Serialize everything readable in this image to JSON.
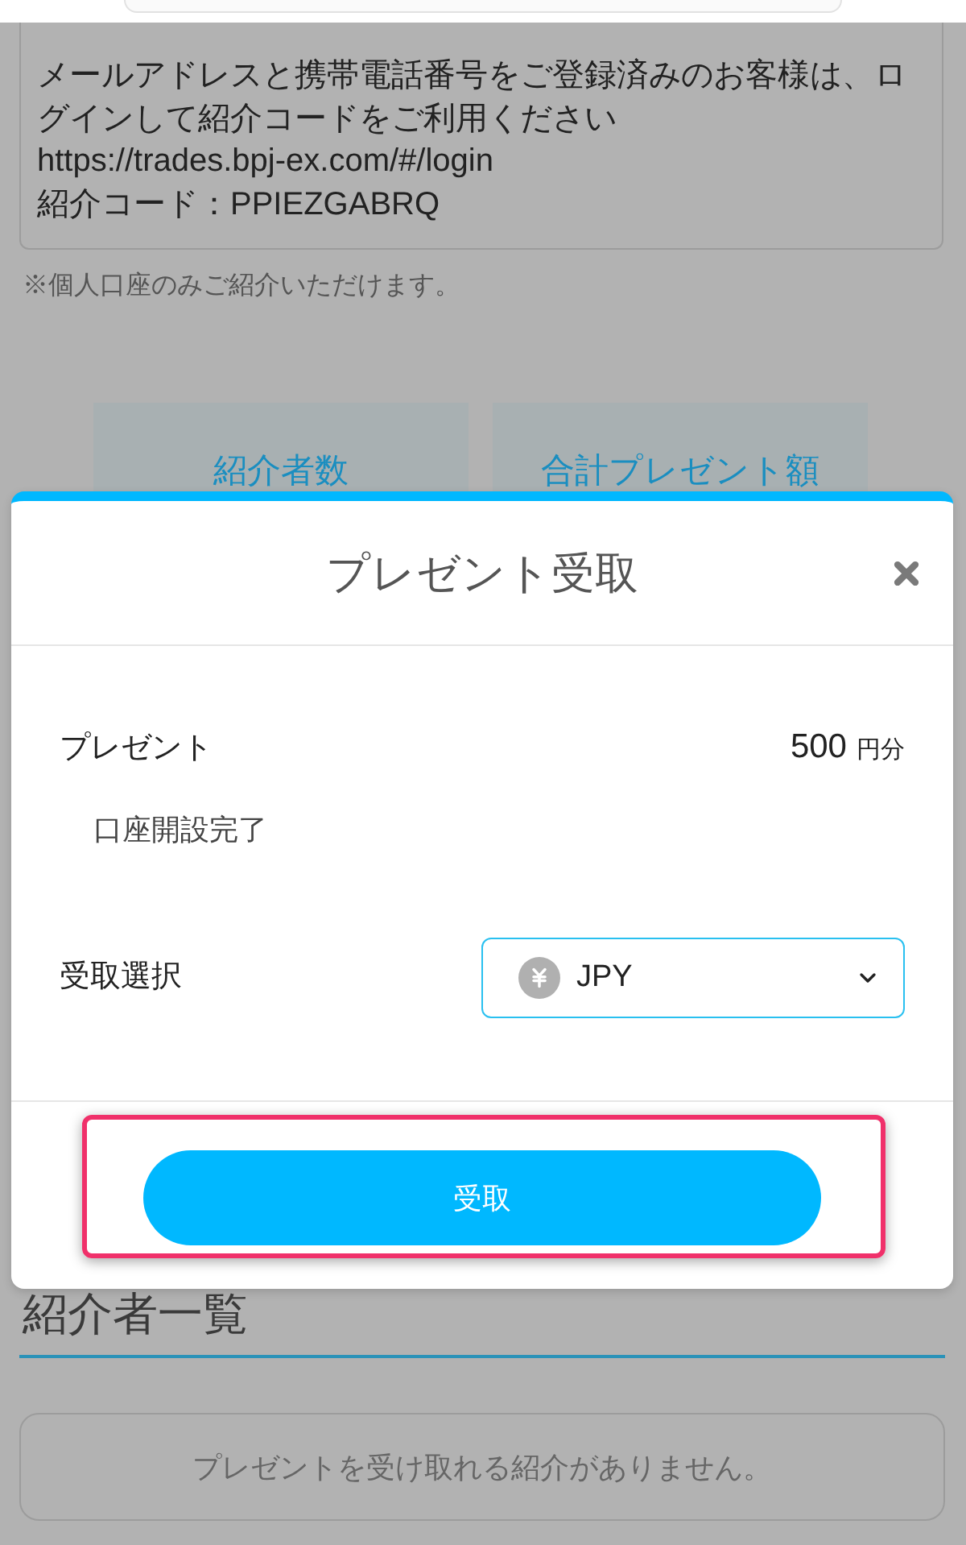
{
  "page": {
    "referral_message": {
      "text": "メールアドレスと携帯電話番号をご登録済みのお客様は、ログインして紹介コードをご利用ください",
      "url": "https://trades.bpj-ex.com/#/login",
      "code_line": "紹介コード：PPIEZGABRQ"
    },
    "note": "※個人口座のみご紹介いただけます。",
    "stat_cards": [
      {
        "label": "紹介者数"
      },
      {
        "label": "合計プレゼント額"
      }
    ],
    "referral_list": {
      "title": "紹介者一覧",
      "empty_message": "プレゼントを受け取れる紹介がありません。"
    }
  },
  "modal": {
    "title": "プレゼント受取",
    "present": {
      "label": "プレゼント",
      "amount": "500",
      "unit": "円分",
      "description": "口座開設完了"
    },
    "receive_select": {
      "label": "受取選択",
      "value": "JPY"
    },
    "submit": {
      "label": "受取",
      "highlighted": true
    }
  }
}
